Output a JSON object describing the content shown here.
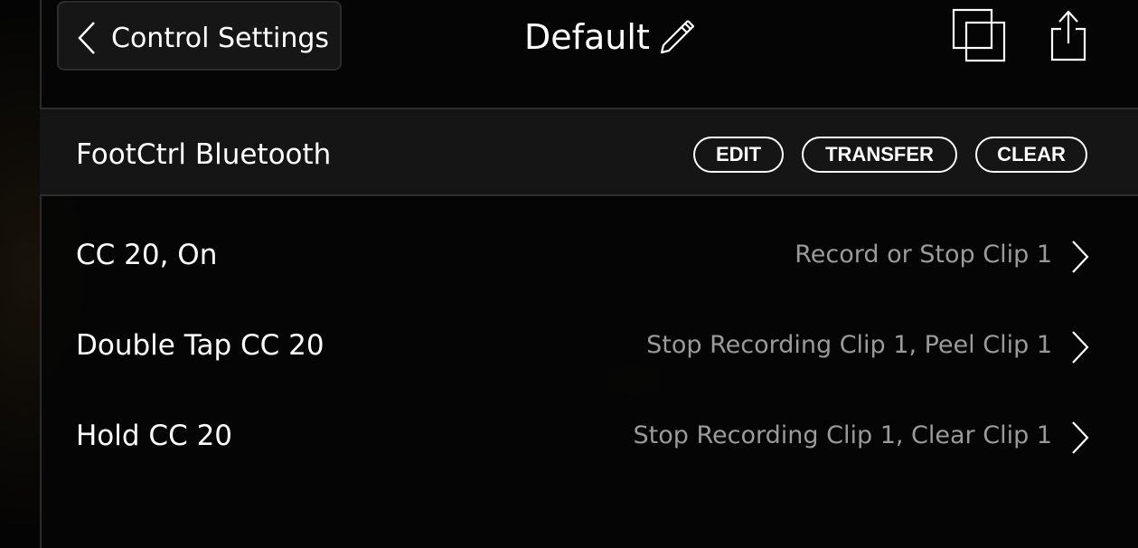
{
  "header": {
    "back_label": "Control Settings",
    "title": "Default",
    "icons": {
      "back": "chevron-left-icon",
      "edit": "pencil-icon",
      "duplicate": "duplicate-icon",
      "share": "share-icon"
    }
  },
  "device": {
    "name": "FootCtrl Bluetooth",
    "buttons": {
      "edit": "EDIT",
      "transfer": "TRANSFER",
      "clear": "CLEAR"
    }
  },
  "mappings": [
    {
      "trigger": "CC 20, On",
      "action": "Record or Stop Clip 1"
    },
    {
      "trigger": "Double Tap CC 20",
      "action": "Stop Recording Clip 1, Peel Clip 1"
    },
    {
      "trigger": "Hold CC 20",
      "action": "Stop Recording Clip 1, Clear Clip 1"
    }
  ],
  "colors": {
    "background": "#000000",
    "text": "#ffffff",
    "secondary_text": "#9a9a9a",
    "device_bar": "#151515"
  }
}
